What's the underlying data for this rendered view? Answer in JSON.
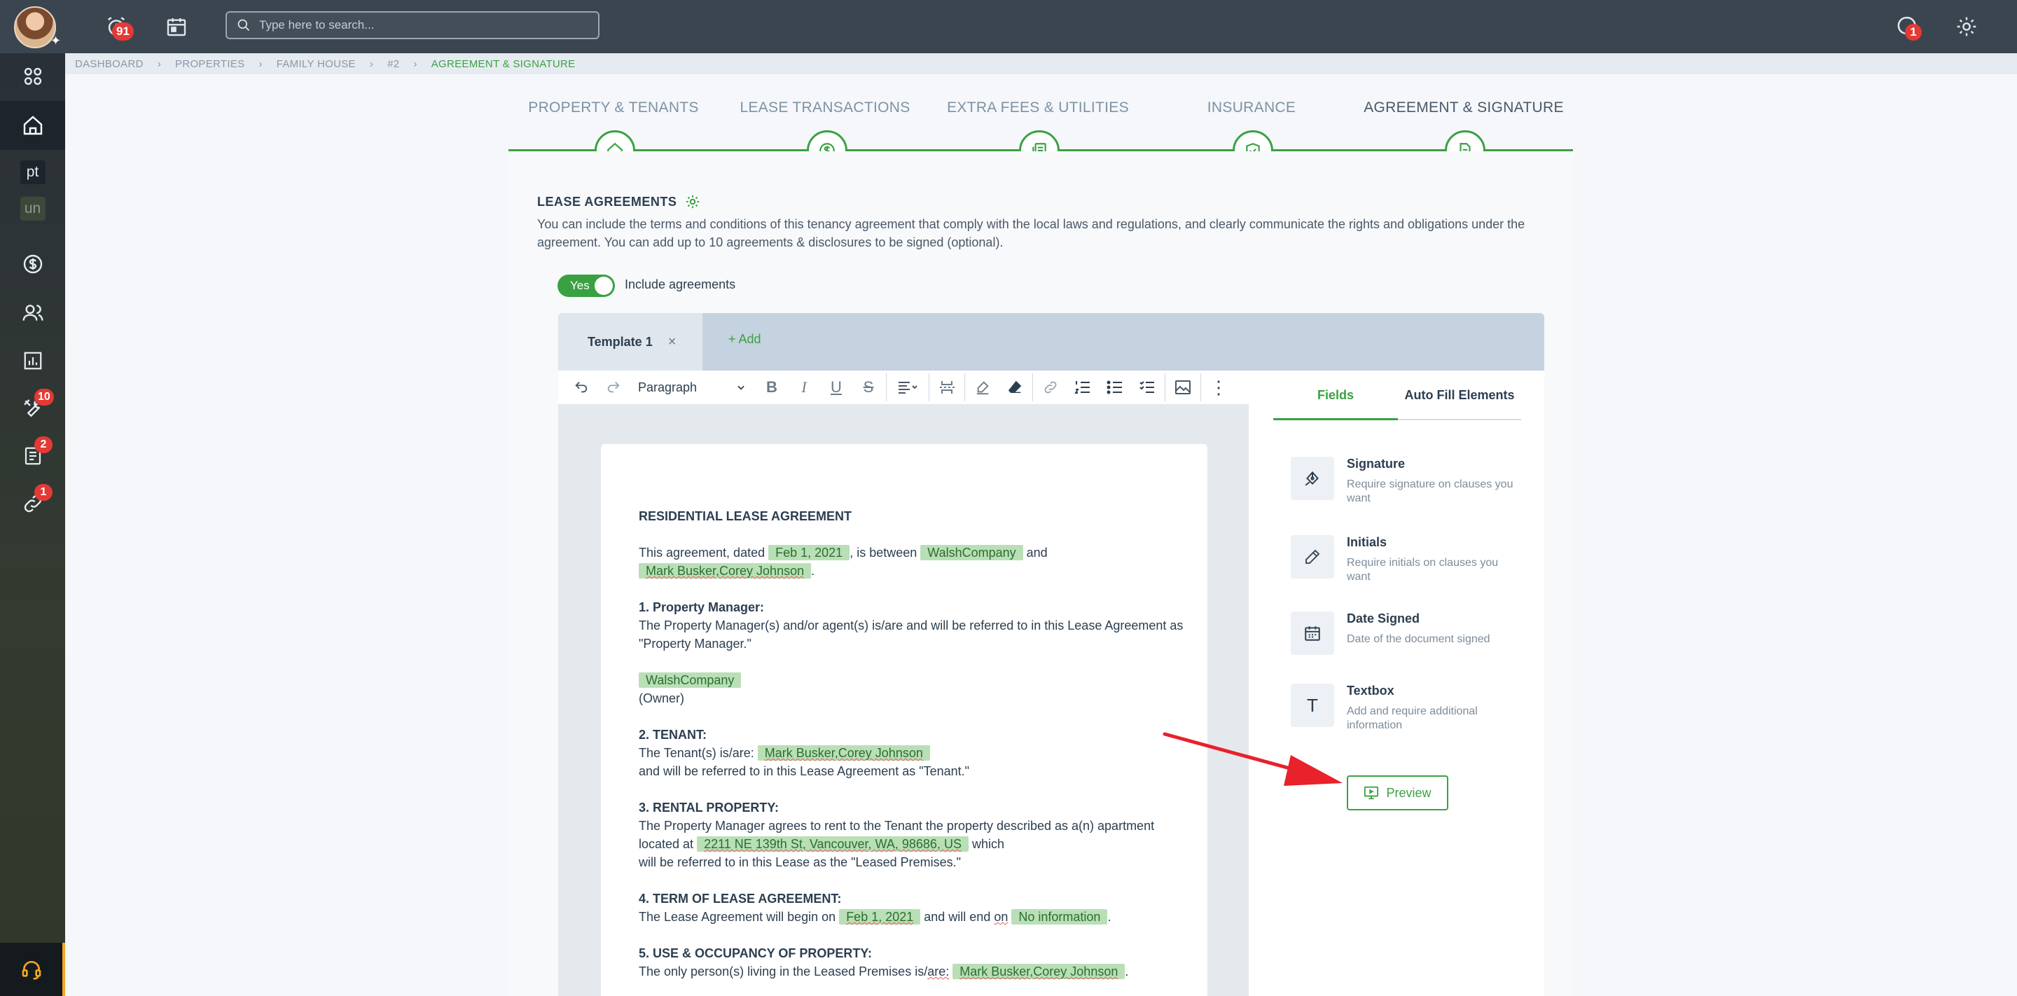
{
  "header": {
    "search_placeholder": "Type here to search...",
    "alerts_count": "91",
    "messages_count": "1"
  },
  "sidebar": {
    "items": [
      {
        "icon": "grid-icon"
      },
      {
        "icon": "home-icon",
        "active": true
      },
      {
        "label": "pt"
      },
      {
        "label": "un"
      },
      {
        "icon": "dollar-icon"
      },
      {
        "icon": "people-icon"
      },
      {
        "icon": "chart-icon"
      },
      {
        "icon": "tools-icon",
        "badge": "10"
      },
      {
        "icon": "document-icon",
        "badge": "2"
      },
      {
        "icon": "link-icon",
        "badge": "1"
      }
    ]
  },
  "breadcrumb": [
    "DASHBOARD",
    "PROPERTIES",
    "FAMILY HOUSE",
    "#2",
    "AGREEMENT & SIGNATURE"
  ],
  "steps": [
    {
      "label": "PROPERTY & TENANTS",
      "icon": "home-icon"
    },
    {
      "label": "LEASE TRANSACTIONS",
      "icon": "dollar-icon"
    },
    {
      "label": "EXTRA FEES & UTILITIES",
      "icon": "bills-icon"
    },
    {
      "label": "INSURANCE",
      "icon": "shield-check-icon"
    },
    {
      "label": "AGREEMENT & SIGNATURE",
      "icon": "document-icon",
      "active": true
    }
  ],
  "section": {
    "title": "LEASE AGREEMENTS",
    "description": "You can include the terms and conditions of this tenancy agreement that comply with the local laws and regulations, and clearly communicate the rights and obligations under the agreement. You can add up to 10 agreements & disclosures to be signed (optional).",
    "toggle_value": "Yes",
    "toggle_label": "Include agreements"
  },
  "template_tabs": {
    "active": "Template 1",
    "close": "×",
    "add": "+ Add"
  },
  "toolbar": {
    "block_format": "Paragraph"
  },
  "document": {
    "title": "RESIDENTIAL LEASE AGREEMENT",
    "intro_1": "This agreement, dated ",
    "date": "Feb 1, 2021",
    "intro_2": ", is between ",
    "company": "WalshCompany",
    "intro_3": " and",
    "tenants": "Mark Busker,Corey Johnson",
    "s1_title": "1. Property Manager:",
    "s1_text": "The Property Manager(s) and/or agent(s) is/are and will be referred to in this Lease Agreement as \"Property Manager.\"",
    "owner_label": "(Owner)",
    "s2_title": "2. TENANT:",
    "s2_text_1": "The Tenant(s) is/are: ",
    "s2_text_2": "and will be referred to in this Lease Agreement as \"Tenant.\"",
    "s3_title": "3. RENTAL PROPERTY:",
    "s3_text_1": "The Property Manager agrees to rent to the Tenant the property described as a(n) apartment located at ",
    "address": "2211 NE 139th St, Vancouver, WA, 98686, US",
    "s3_text_2": " which",
    "s3_text_3": "will be referred to in this Lease as the \"Leased Premises.\"",
    "s4_title": "4. TERM OF LEASE AGREEMENT:",
    "s4_text_1": "The Lease Agreement will begin on ",
    "start_date": "Feb 1, 2021",
    "s4_text_2": " and will end ",
    "s4_on": "on",
    "end_date": "No information",
    "s5_title": "5. USE & OCCUPANCY OF PROPERTY:",
    "s5_text_1": "The only person(s) living in the Leased Premises is/",
    "s5_are": "are:",
    "period": "."
  },
  "panel": {
    "tabs": [
      "Fields",
      "Auto Fill Elements"
    ],
    "fields": [
      {
        "name": "Signature",
        "desc": "Require signature on clauses you want",
        "icon": "pen-nib-icon"
      },
      {
        "name": "Initials",
        "desc": "Require initials on clauses you want",
        "icon": "pencil-icon"
      },
      {
        "name": "Date Signed",
        "desc": "Date of the document signed",
        "icon": "calendar-icon"
      },
      {
        "name": "Textbox",
        "desc": "Add and require additional information",
        "icon": "text-icon"
      }
    ],
    "preview_label": "Preview"
  },
  "colors": {
    "accent": "#3aa142",
    "topbar": "#3b4550",
    "badge": "#e53935",
    "arrow": "#e8212a"
  }
}
